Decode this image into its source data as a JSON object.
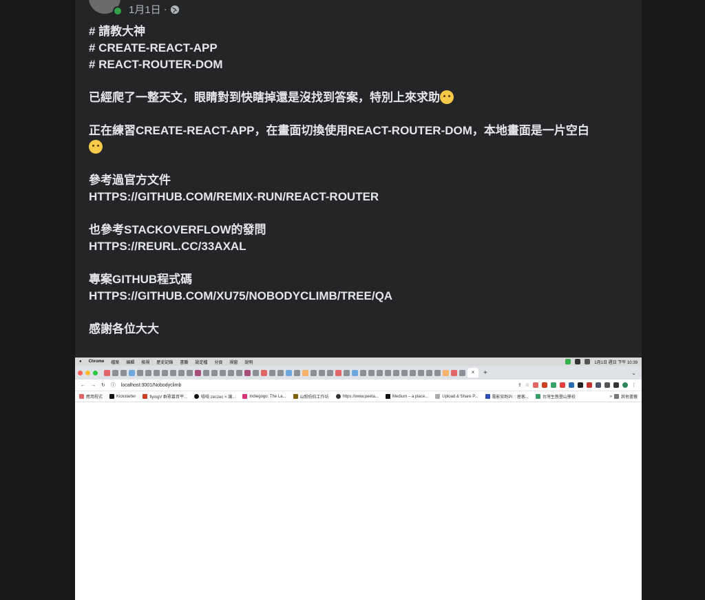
{
  "post": {
    "date": "1月1日",
    "separator": "·",
    "lines": {
      "tag1": "# 請教大神",
      "tag2": "# CREATE-REACT-APP",
      "tag3": "# REACT-ROUTER-DOM",
      "p1": "已經爬了一整天文，眼睛對到快瞎掉還是沒找到答案，特別上來求助",
      "p2": "正在練習CREATE-REACT-APP，在畫面切換使用REACT-ROUTER-DOM，本地畫面是一片空白",
      "p3a": "參考過官方文件",
      "p3b": "HTTPS://GITHUB.COM/REMIX-RUN/REACT-ROUTER",
      "p4a": "也參考STACKOVERFLOW的發問",
      "p4b": "HTTPS://REURL.CC/33AXAL",
      "p5a": "專案GITHUB程式碼",
      "p5b": "HTTPS://GITHUB.COM/XU75/NOBODYCLIMB/TREE/QA",
      "p6": "感謝各位大大"
    }
  },
  "screenshot": {
    "menubar": {
      "app": "Chrome",
      "items": [
        "檔案",
        "編輯",
        "檢視",
        "歷史記錄",
        "書籤",
        "設定檔",
        "分頁",
        "視窗",
        "說明"
      ],
      "clock": "1月1日 週日 下午 10:39"
    },
    "active_tab_close": "×",
    "new_tab": "+",
    "url": "localhost:3001/Nobodyclimb",
    "bookmarks": [
      "應用程式",
      "Kickstarter",
      "flyingV 群眾募資平...",
      "嘖嘖 zeczec × 讓...",
      "Indiegogo: The La...",
      "山殼伯伯工作坊",
      "https://www.peeta...",
      "Medium – a place...",
      "Upload & Share P...",
      "電影狂粉PI :: 痞客...",
      "台灣生態登山學校"
    ],
    "other_bookmarks": "其他書籤",
    "colors": {
      "close": "#ff5f57",
      "minimize": "#febc2e",
      "zoom": "#28c840"
    }
  }
}
